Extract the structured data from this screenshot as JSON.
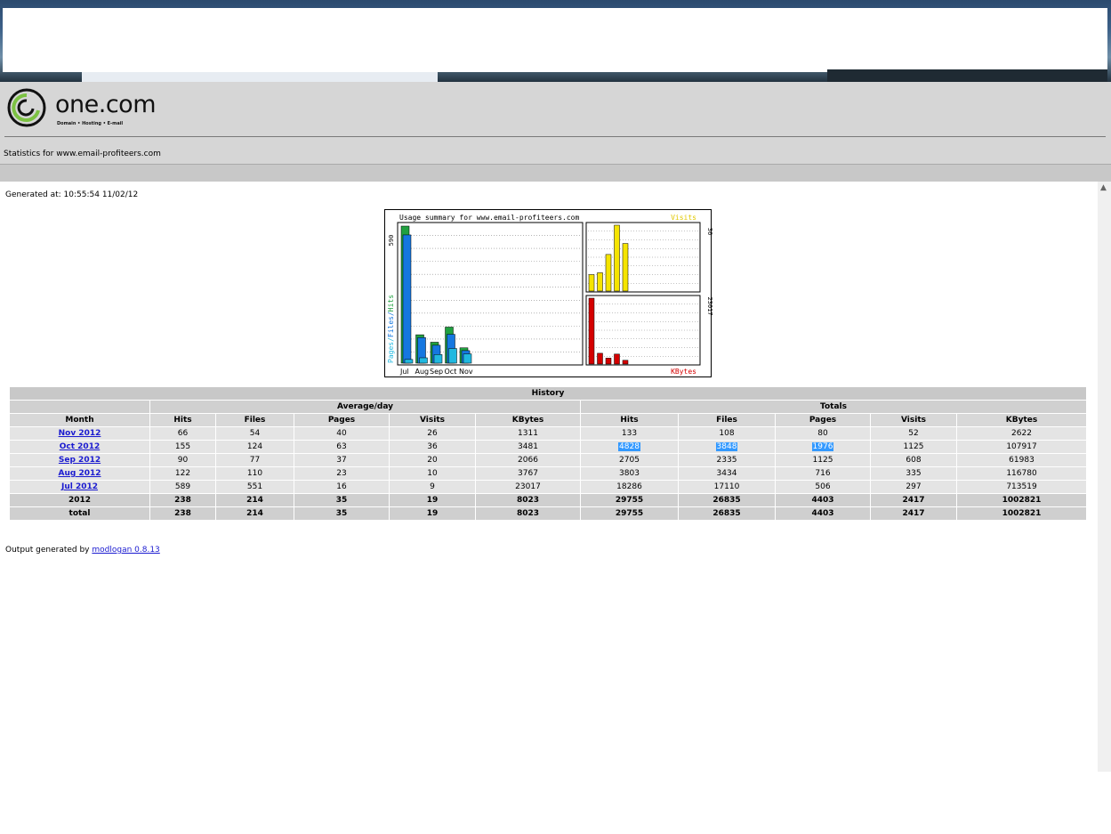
{
  "site": {
    "brand": "one.com",
    "tagline": "Domain • Hosting • E-mail",
    "stats_title": "Statistics for www.email-profiteers.com",
    "generated": "Generated at: 10:55:54 11/02/12"
  },
  "chart_data": [
    {
      "type": "bar",
      "title": "Usage summary for www.email-profiteers.com",
      "ylabel": "Pages/Files/Hits",
      "ymax_label": "590",
      "categories": [
        "Jul",
        "Aug",
        "Sep",
        "Oct",
        "Nov"
      ],
      "series": [
        {
          "name": "Hits",
          "color": "#20a040",
          "values": [
            589,
            122,
            90,
            155,
            66
          ]
        },
        {
          "name": "Files",
          "color": "#1577e0",
          "values": [
            551,
            110,
            77,
            124,
            54
          ]
        },
        {
          "name": "Pages",
          "color": "#20b8e0",
          "values": [
            16,
            23,
            37,
            63,
            40
          ]
        }
      ]
    },
    {
      "type": "bar",
      "title": "Visits",
      "ymax_label": "36",
      "categories": [
        "Jul",
        "Aug",
        "Sep",
        "Oct",
        "Nov"
      ],
      "series": [
        {
          "name": "Visits",
          "color": "#f5e400",
          "values": [
            9,
            10,
            20,
            36,
            26
          ]
        }
      ]
    },
    {
      "type": "bar",
      "title": "KBytes",
      "ymax_label": "23017",
      "categories": [
        "Jul",
        "Aug",
        "Sep",
        "Oct",
        "Nov"
      ],
      "series": [
        {
          "name": "KBytes",
          "color": "#d40000",
          "values": [
            23017,
            3767,
            2066,
            3481,
            1311
          ]
        }
      ]
    }
  ],
  "history": {
    "title": "History",
    "group_avg": "Average/day",
    "group_tot": "Totals",
    "headers": [
      "Month",
      "Hits",
      "Files",
      "Pages",
      "Visits",
      "KBytes",
      "Hits",
      "Files",
      "Pages",
      "Visits",
      "KBytes"
    ],
    "rows": [
      {
        "month": "Nov 2012",
        "cells": [
          "66",
          "54",
          "40",
          "26",
          "1311",
          "133",
          "108",
          "80",
          "52",
          "2622"
        ]
      },
      {
        "month": "Oct 2012",
        "cells": [
          "155",
          "124",
          "63",
          "36",
          "3481",
          "4828",
          "3848",
          "1976",
          "1125",
          "107917"
        ]
      },
      {
        "month": "Sep 2012",
        "cells": [
          "90",
          "77",
          "37",
          "20",
          "2066",
          "2705",
          "2335",
          "1125",
          "608",
          "61983"
        ]
      },
      {
        "month": "Aug 2012",
        "cells": [
          "122",
          "110",
          "23",
          "10",
          "3767",
          "3803",
          "3434",
          "716",
          "335",
          "116780"
        ]
      },
      {
        "month": "Jul 2012",
        "cells": [
          "589",
          "551",
          "16",
          "9",
          "23017",
          "18286",
          "17110",
          "506",
          "297",
          "713519"
        ]
      }
    ],
    "sums": [
      {
        "label": "2012",
        "cells": [
          "238",
          "214",
          "35",
          "19",
          "8023",
          "29755",
          "26835",
          "4403",
          "2417",
          "1002821"
        ]
      },
      {
        "label": "total",
        "cells": [
          "238",
          "214",
          "35",
          "19",
          "8023",
          "29755",
          "26835",
          "4403",
          "2417",
          "1002821"
        ]
      }
    ]
  },
  "footer": {
    "prefix": "Output generated by ",
    "link": "modlogan 0.8.13"
  }
}
